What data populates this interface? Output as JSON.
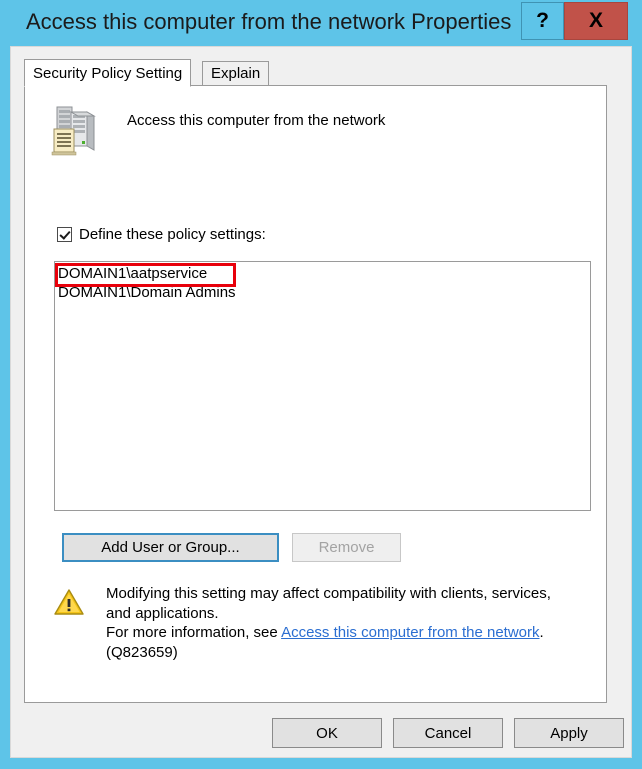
{
  "window": {
    "title": "Access this computer from the network Properties",
    "frame_color": "#5ec4e8",
    "body_color": "#f0f0f0"
  },
  "titlebar": {
    "help_label": "?",
    "close_label": "X",
    "close_color": "#c15249"
  },
  "tabs": [
    {
      "label": "Security Policy Setting",
      "active": true
    },
    {
      "label": "Explain",
      "active": false
    }
  ],
  "policy": {
    "icon": "server-computer-icon",
    "name": "Access this computer from the network"
  },
  "define": {
    "checked": true,
    "label": "Define these policy settings:"
  },
  "members": {
    "items": [
      "DOMAIN1\\aatpservice",
      "DOMAIN1\\Domain Admins"
    ]
  },
  "annotation": {
    "color": "#e8000b",
    "target": "DOMAIN1\\aatpservice"
  },
  "actions": {
    "add_label": "Add User or Group...",
    "remove_label": "Remove",
    "remove_enabled": false,
    "focus_color": "#3b8ec2"
  },
  "warning": {
    "icon": "warning-triangle-icon",
    "line1": "Modifying this setting may affect compatibility with clients, services,",
    "line2": "and applications.",
    "line3_prefix": "For more information, see ",
    "link_text": "Access this computer from the network",
    "line3_suffix": ".",
    "line4": "(Q823659)",
    "link_color": "#2b6ed1"
  },
  "footer": {
    "ok_label": "OK",
    "cancel_label": "Cancel",
    "apply_label": "Apply"
  }
}
